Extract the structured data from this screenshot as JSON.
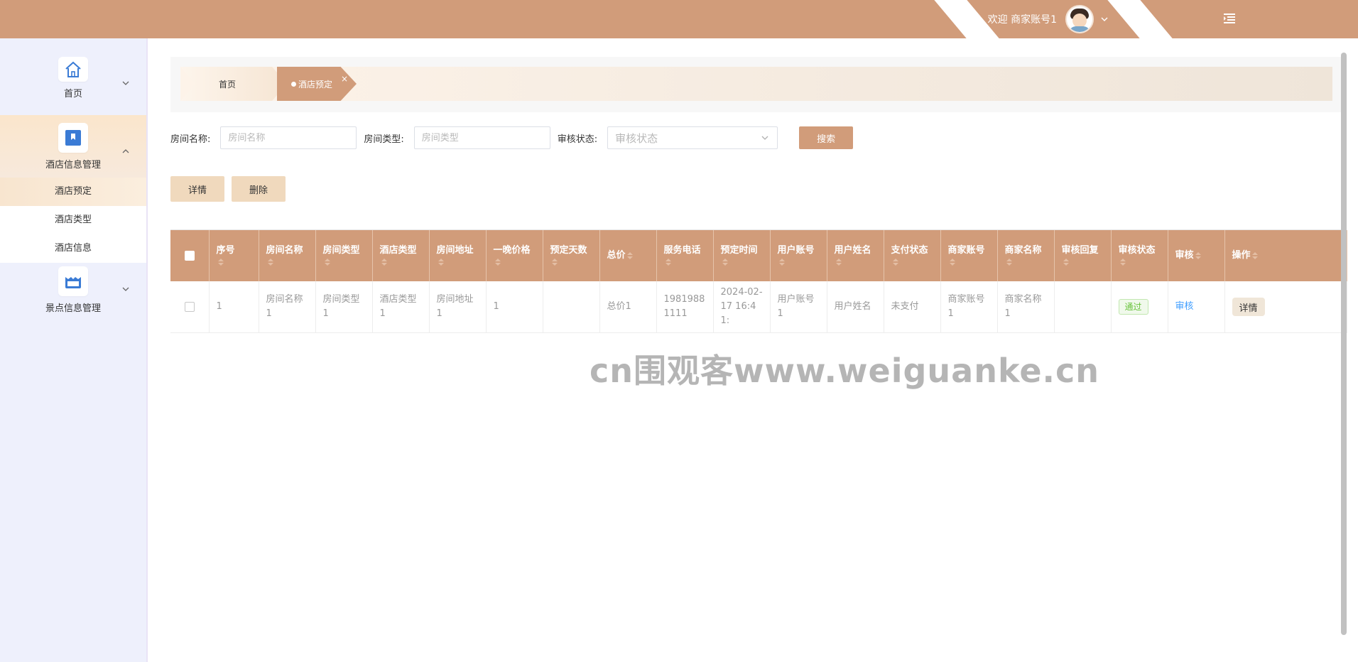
{
  "header": {
    "welcome_label": "欢迎 商家账号1",
    "avatar_icon": "avatar-icon",
    "menu_icon": "menu-fold-icon",
    "bg_color": "#d19c7a"
  },
  "sidebar": {
    "groups": [
      {
        "label": "首页",
        "icon": "home-icon",
        "expanded": false
      },
      {
        "label": "酒店信息管理",
        "icon": "bookmark-icon",
        "expanded": true,
        "items": [
          {
            "label": "酒店预定",
            "active": true
          },
          {
            "label": "酒店类型",
            "active": false
          },
          {
            "label": "酒店信息",
            "active": false
          }
        ]
      },
      {
        "label": "景点信息管理",
        "icon": "scenic-icon",
        "expanded": false
      }
    ]
  },
  "tabs": [
    {
      "label": "首页",
      "active": false
    },
    {
      "label": "酒店预定",
      "active": true,
      "close": "×"
    }
  ],
  "filters": {
    "room_name": {
      "label": "房间名称:",
      "placeholder": "房间名称"
    },
    "room_type": {
      "label": "房间类型:",
      "placeholder": "房间类型"
    },
    "audit_status": {
      "label": "审核状态:",
      "placeholder": "审核状态"
    },
    "search_label": "搜索"
  },
  "actions": {
    "detail_label": "详情",
    "delete_label": "删除"
  },
  "table": {
    "columns": [
      "序号",
      "房间名称",
      "房间类型",
      "酒店类型",
      "房间地址",
      "一晚价格",
      "预定天数",
      "总价",
      "服务电话",
      "预定时间",
      "用户账号",
      "用户姓名",
      "支付状态",
      "商家账号",
      "商家名称",
      "审核回复",
      "审核状态",
      "审核",
      "操作"
    ],
    "rows": [
      {
        "index": "1",
        "room_name": "房间名称1",
        "room_type": "房间类型1",
        "hotel_type": "酒店类型1",
        "room_address": "房间地址1",
        "price_per_night": "1",
        "days": "",
        "total_price": "总价1",
        "service_phone": "19819881111",
        "booking_time": "2024-02-17 16:41:",
        "user_account": "用户账号1",
        "user_name": "用户姓名",
        "pay_status": "未支付",
        "merchant_account": "商家账号1",
        "merchant_name": "商家名称1",
        "audit_reply": "",
        "audit_status": "通过",
        "audit_link": "审核",
        "detail_btn": "详情"
      }
    ]
  },
  "watermark": "cn围观客www.weiguanke.cn",
  "colors": {
    "primary": "#d19c7a",
    "light_button": "#f0d9bd",
    "sidebar_bg": "#eef0fc",
    "link": "#409eff",
    "success": "#67c23a"
  }
}
